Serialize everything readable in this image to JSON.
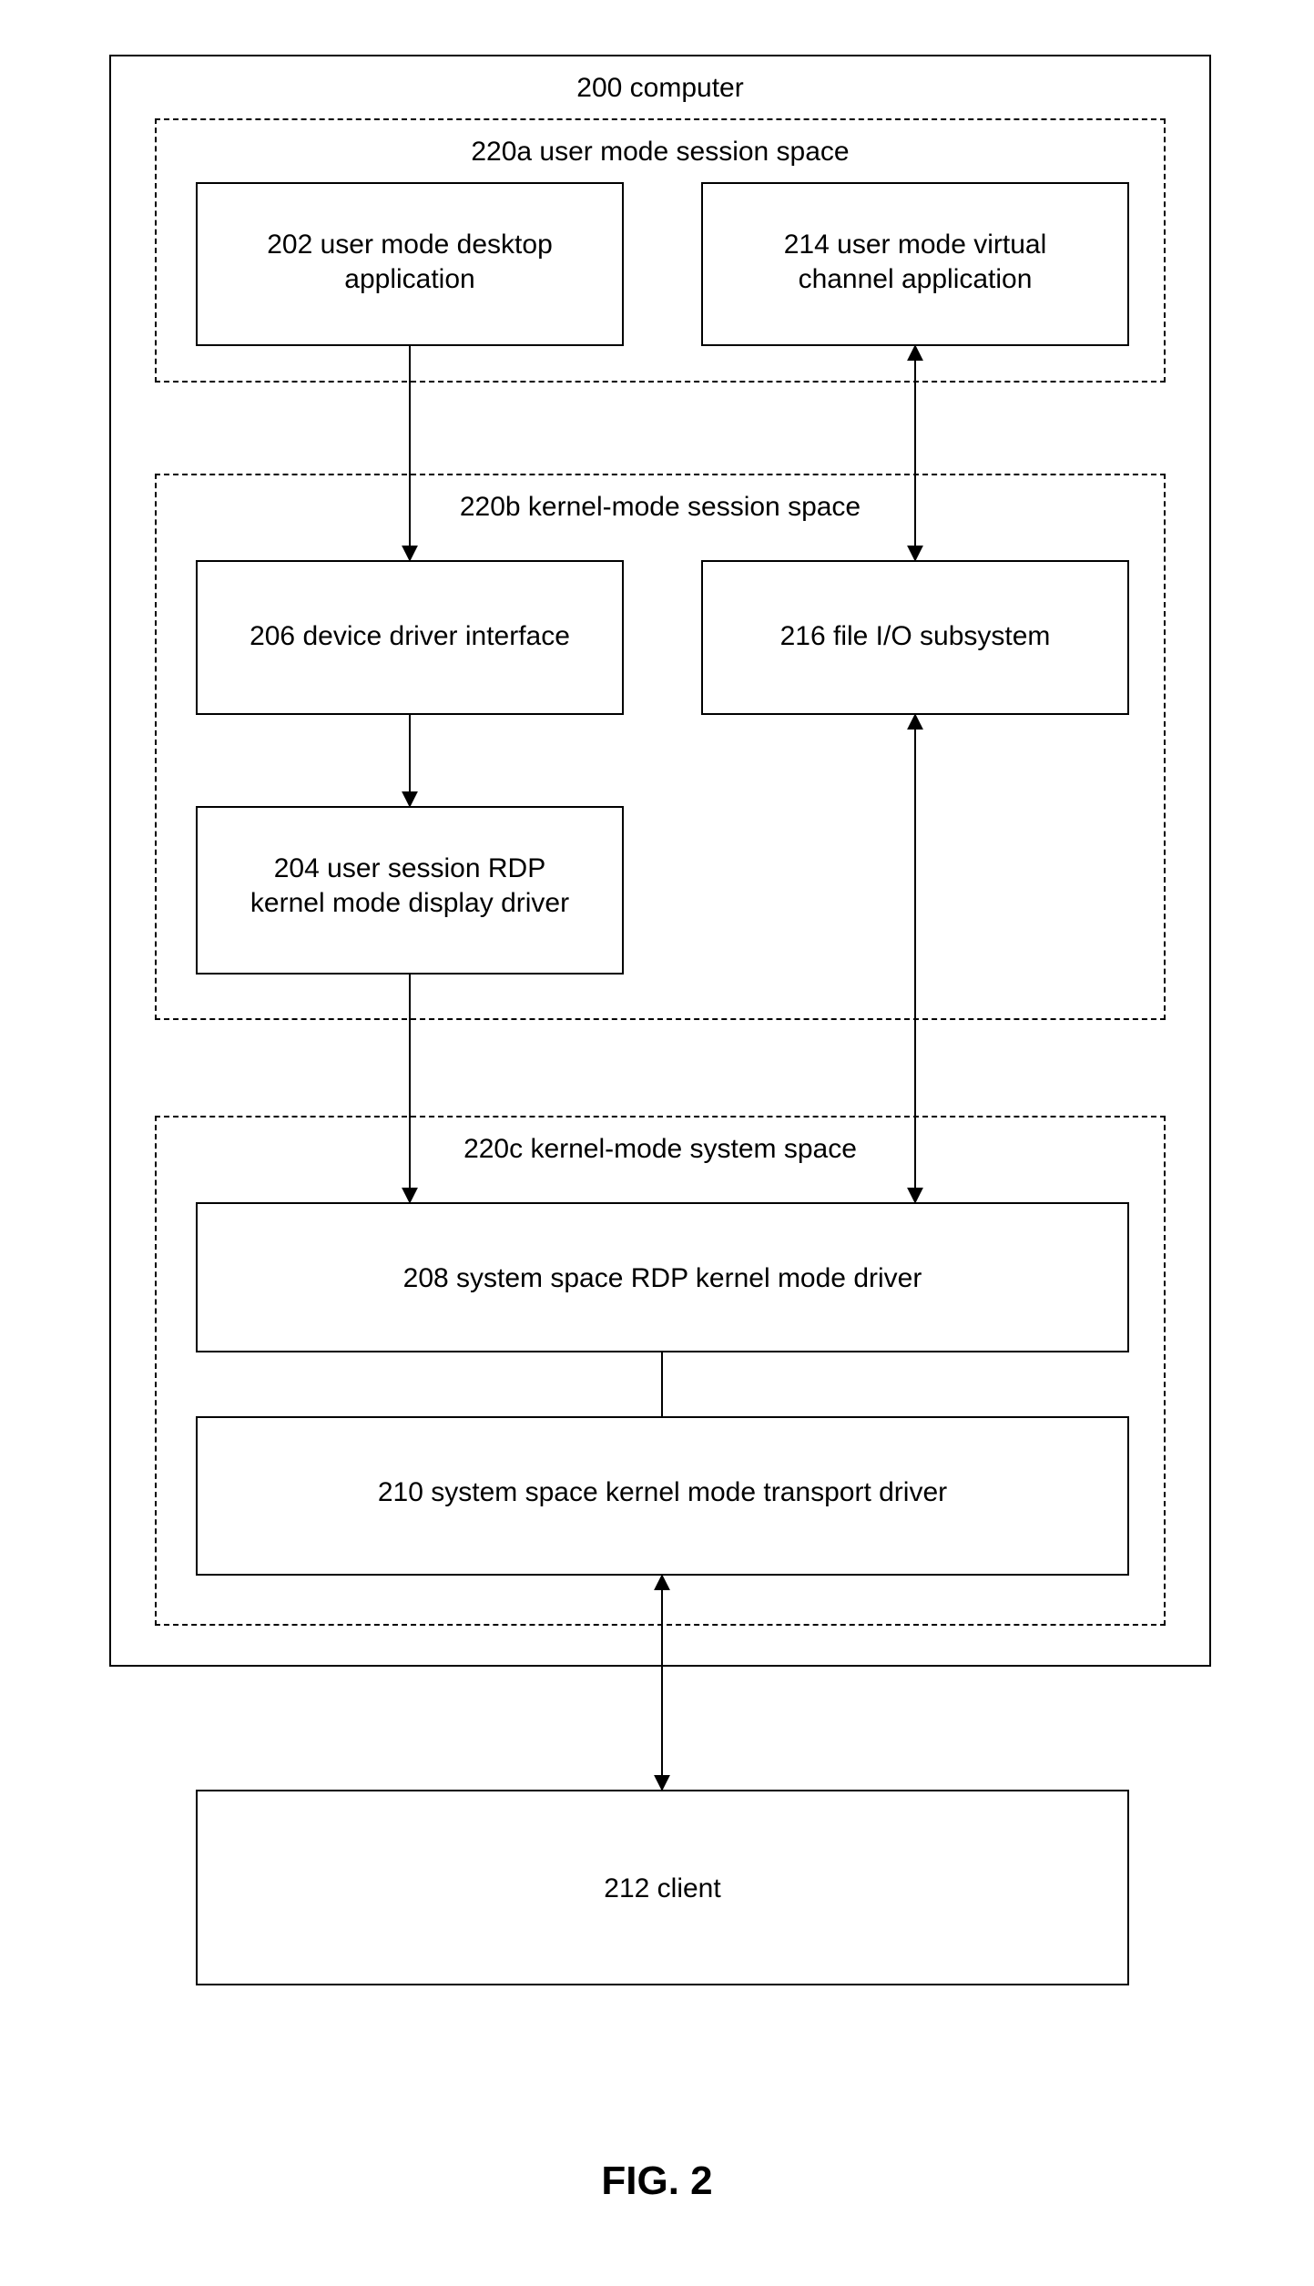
{
  "computer": {
    "title": "200 computer",
    "section_a": {
      "title": "220a user mode session space",
      "box_202": "202 user mode desktop\napplication",
      "box_214": "214 user mode virtual\nchannel application"
    },
    "section_b": {
      "title": "220b kernel-mode session space",
      "box_206": "206 device driver interface",
      "box_204": "204 user session RDP\nkernel mode display driver",
      "box_216": "216 file I/O subsystem"
    },
    "section_c": {
      "title": "220c kernel-mode system space",
      "box_208": "208 system space RDP kernel mode driver",
      "box_210": "210 system space kernel mode transport driver"
    }
  },
  "client": {
    "title": "212 client"
  },
  "figure": "FIG. 2"
}
